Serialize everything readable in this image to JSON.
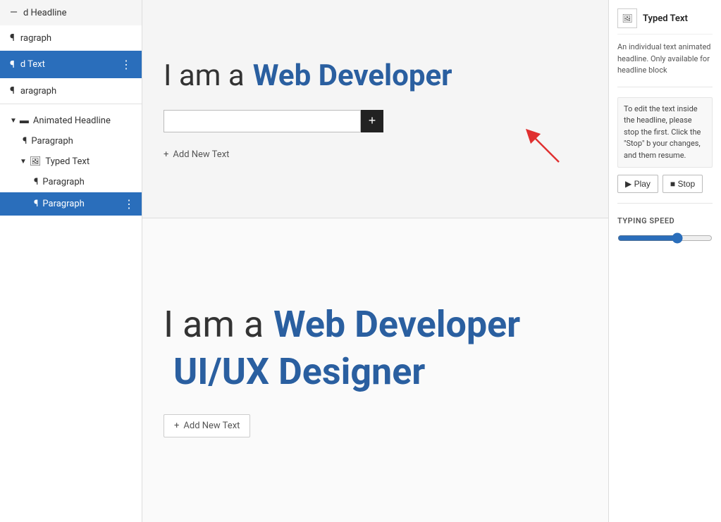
{
  "sidebar_top": {
    "items": [
      {
        "id": "headline",
        "label": "d Headline",
        "icon": "—",
        "active": false
      },
      {
        "id": "paragraph1",
        "label": "ragraph",
        "icon": "¶",
        "active": false
      },
      {
        "id": "typed-text",
        "label": "d Text",
        "icon": "¶",
        "active": true,
        "more": "⋮"
      },
      {
        "id": "paragraph2",
        "label": "aragraph",
        "icon": "¶",
        "active": false
      }
    ]
  },
  "sidebar_bottom": {
    "layers": [
      {
        "id": "animated-headline",
        "label": "Animated Headline",
        "indent": 0,
        "expand": "▼",
        "icon": "▬",
        "active": false
      },
      {
        "id": "paragraph-1",
        "label": "Paragraph",
        "indent": 1,
        "expand": "",
        "icon": "¶",
        "active": false
      },
      {
        "id": "typed-text-layer",
        "label": "Typed Text",
        "indent": 1,
        "expand": "▼",
        "icon": "🖼",
        "active": false
      },
      {
        "id": "paragraph-2",
        "label": "Paragraph",
        "indent": 2,
        "expand": "",
        "icon": "¶",
        "active": false
      },
      {
        "id": "paragraph-3",
        "label": "Paragraph",
        "indent": 2,
        "expand": "",
        "icon": "¶",
        "active": true,
        "more": "⋮"
      }
    ]
  },
  "canvas_top": {
    "headline_prefix": "I am a ",
    "headline_typed": "Web Developer",
    "input_placeholder": "",
    "add_button_label": "+",
    "add_new_text_label": "Add New Text"
  },
  "canvas_bottom": {
    "headline_prefix": "I am a ",
    "headline_typed": "Web Developer",
    "headline_line2": "UI/UX Designer",
    "add_new_text_label": "Add New Text"
  },
  "right_panel": {
    "header": {
      "icon": "🖼",
      "title": "Typed Text"
    },
    "description": "An individual text animated headline. Only available for headline block",
    "info_text": "To edit the text inside the headline, please stop the first. Click the \"Stop\" b your changes, and them resume.",
    "play_label": "▶  Play",
    "stop_label": "■  Stop",
    "typing_speed_label": "TYPING SPEED",
    "slider_value": 65
  }
}
